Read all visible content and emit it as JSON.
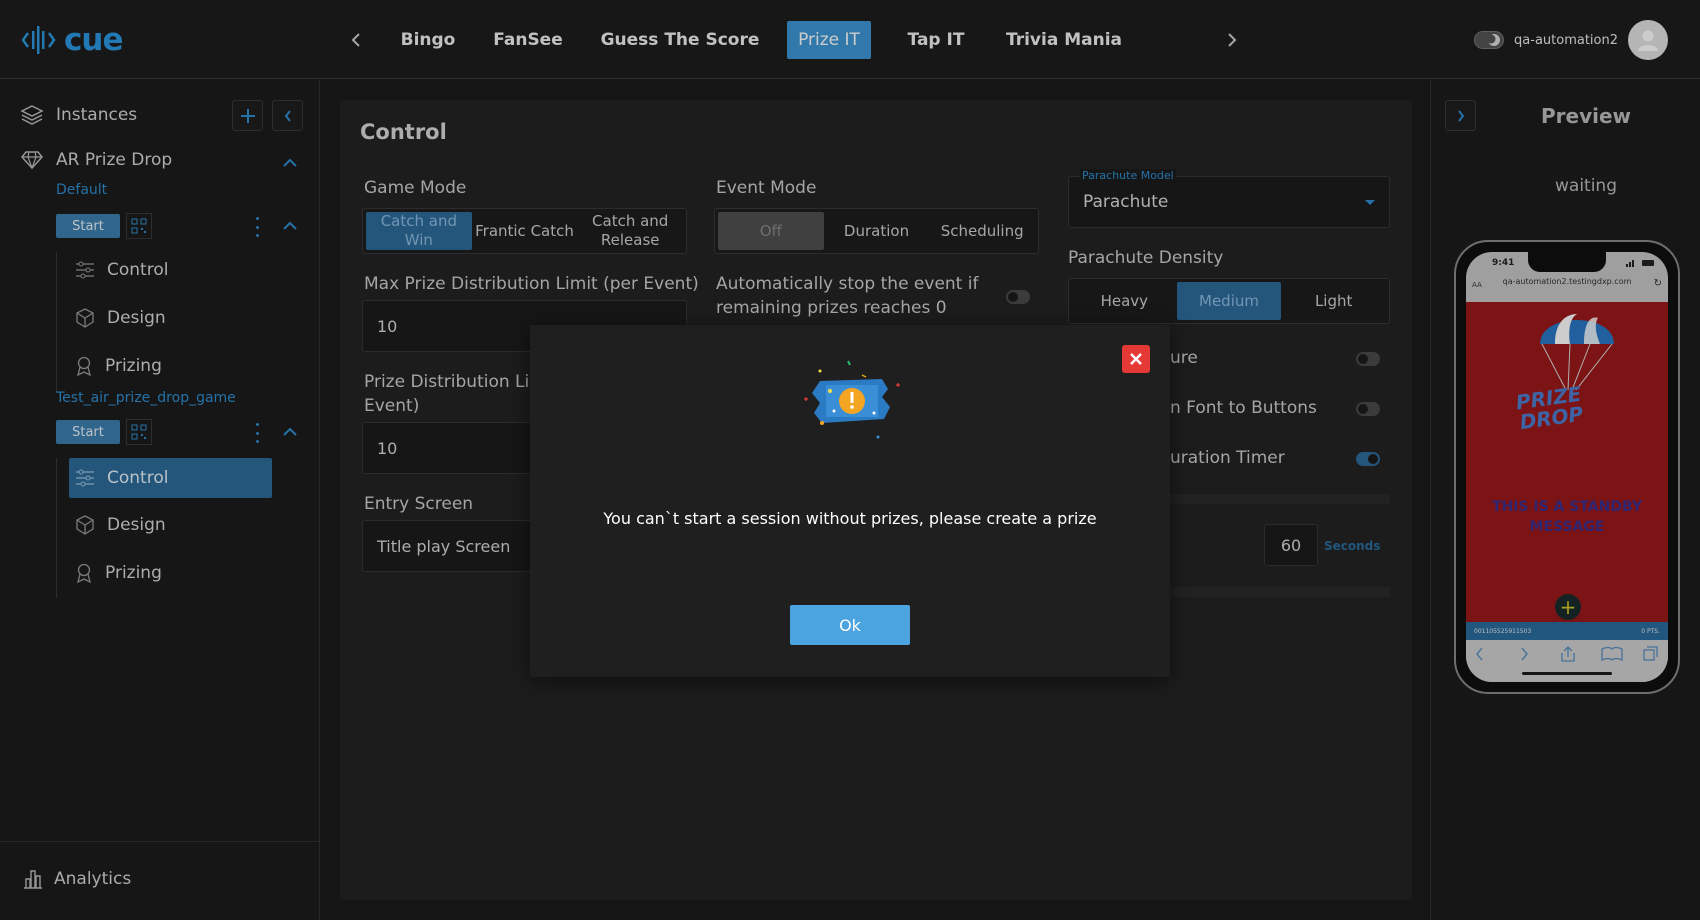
{
  "header": {
    "logo_text": "cue",
    "tabs": [
      "Bingo",
      "FanSee",
      "Guess The Score",
      "Prize IT",
      "Tap IT",
      "Trivia Mania"
    ],
    "active_tab": "Prize IT",
    "username": "qa-automation2"
  },
  "sidebar": {
    "instances_label": "Instances",
    "game_title": "AR Prize Drop",
    "instances": [
      {
        "name": "Default",
        "start_label": "Start",
        "items": [
          "Control",
          "Design",
          "Prizing"
        ]
      },
      {
        "name": "Test_air_prize_drop_game",
        "start_label": "Start",
        "items": [
          "Control",
          "Design",
          "Prizing"
        ]
      }
    ],
    "active_item": "Control",
    "analytics_label": "Analytics"
  },
  "control": {
    "title": "Control",
    "game_mode": {
      "label": "Game Mode",
      "options": [
        "Catch and Win",
        "Frantic Catch",
        "Catch and Release"
      ],
      "selected": "Catch and Win"
    },
    "event_mode": {
      "label": "Event Mode",
      "options": [
        "Off",
        "Duration",
        "Scheduling"
      ],
      "selected": "Off"
    },
    "max_prize_limit": {
      "label": "Max Prize Distribution Limit (per Event)",
      "value": "10"
    },
    "auto_stop": {
      "label": "Automatically stop the event if remaining prizes reaches 0",
      "enabled": false
    },
    "prize_limit_user": {
      "label": "Prize Distribution Limi Event)",
      "value": "10"
    },
    "entry_screen": {
      "label": "Entry Screen",
      "value": "Title play Screen"
    },
    "parachute_model": {
      "label": "Parachute Model",
      "value": "Parachute"
    },
    "parachute_density": {
      "label": "Parachute Density",
      "options": [
        "Heavy",
        "Medium",
        "Light"
      ],
      "selected": "Medium"
    },
    "toggles": [
      {
        "label": "ure",
        "enabled": false
      },
      {
        "label": "n Font to Buttons",
        "enabled": false
      },
      {
        "label": "uration Timer",
        "enabled": true
      }
    ],
    "timer_value": "60",
    "timer_unit": "Seconds"
  },
  "preview": {
    "title": "Preview",
    "status": "waiting",
    "phone": {
      "time": "9:41",
      "text_size": "AA",
      "url": "qa-automation2.testingdxp.com",
      "game_logo": "PRIZE DROP",
      "standby_message": "THIS IS A STANDBY MESSAGE",
      "user_id": "001105525911503",
      "points": "0 PTS."
    }
  },
  "modal": {
    "message": "You can`t start a session without prizes, please create a prize",
    "ok_label": "Ok"
  },
  "colors": {
    "accent": "#2f8fd3",
    "selected": "#2d6c9c",
    "danger": "#e53935"
  }
}
